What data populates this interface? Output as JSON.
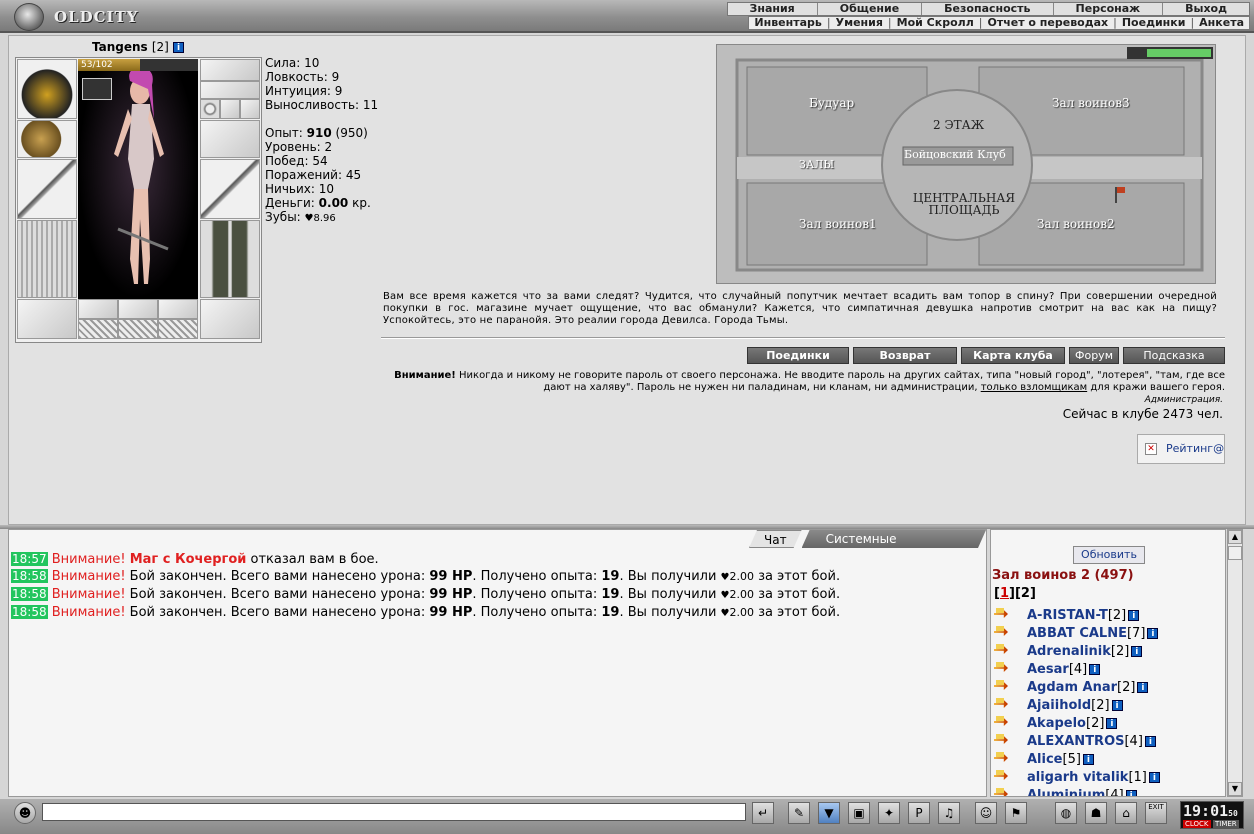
{
  "header": {
    "logo_text": "OLDCITY",
    "menu_top": [
      "Знания",
      "Общение",
      "Безопасность",
      "Персонаж",
      "Выход"
    ],
    "menu_sub": [
      "Инвентарь",
      "Умения",
      "Мой Скролл",
      "Отчет о переводах",
      "Поединки",
      "Анкета"
    ]
  },
  "character": {
    "name": "Tangens",
    "level": "[2]",
    "hp": "53/102",
    "hp_fraction": 0.52,
    "stats": [
      {
        "label": "Сила:",
        "value": "10"
      },
      {
        "label": "Ловкость:",
        "value": "9"
      },
      {
        "label": "Интуиция:",
        "value": "9"
      },
      {
        "label": "Выносливость:",
        "value": "11"
      }
    ],
    "exp_label": "Опыт:",
    "exp_value": "910",
    "exp_next": "(950)",
    "level_label": "Уровень:",
    "level_value": "2",
    "wins_label": "Побед:",
    "wins_value": "54",
    "losses_label": "Поражений:",
    "losses_value": "45",
    "draws_label": "Ничьих:",
    "draws_value": "10",
    "money_label": "Деньги:",
    "money_value": "0.00",
    "money_unit": "кр.",
    "teeth_label": "Зубы:",
    "teeth_value": "8.96"
  },
  "map": {
    "rooms": [
      "Будуар",
      "Зал воинов3",
      "2 ЭТАЖ",
      "Бойцовский Клуб",
      "ЗАЛЫ",
      "ЦЕНТРАЛЬНАЯ ПЛОЩАДЬ",
      "Зал воинов1",
      "Зал воинов2"
    ]
  },
  "flavor_text": "Вам все время кажется что за вами следят? Чудится, что случайный попутчик мечтает всадить вам топор в спину? При совершении очередной покупки в гос. магазине мучает ощущение, что вас обманули? Кажется, что симпатичная девушка напротив смотрит на вас как на пищу? Успокойтесь, это не паранойя. Это реалии города Девилса. Города Тьмы.",
  "buttons": [
    "Поединки",
    "Возврат",
    "Карта клуба",
    "Форум",
    "Подсказка"
  ],
  "warning": {
    "label": "Внимание!",
    "text_1": " Никогда и никому не говорите пароль от своего персонажа. Не вводите пароль на других сайтах, типа \"новый город\", \"лотерея\", \"там, где все дают на халяву\". Пароль не нужен ни паладинам, ни кланам, ни администрации, ",
    "link": "только взломщикам",
    "text_2": " для кражи вашего героя.",
    "signature": "Администрация."
  },
  "online": "Сейчас в клубе 2473 чел.",
  "rating_label": "Рейтинг@",
  "chat": {
    "tabs": [
      "Чат",
      "Системные сообщения"
    ],
    "messages": [
      {
        "time": "18:57",
        "prefix": "Внимание!",
        "nick": "Маг с Кочергой",
        "text": " отказал вам в бое."
      },
      {
        "time": "18:58",
        "prefix": "Внимание!",
        "text": " Бой закончен. Всего вами нанесено урона: ",
        "dmg": "99 HP",
        "text2": ". Получено опыта: ",
        "exp": "19",
        "text3": ". Вы получили ",
        "teeth": "2.00",
        "text4": " за этот бой."
      },
      {
        "time": "18:58",
        "prefix": "Внимание!",
        "text": " Бой закончен. Всего вами нанесено урона: ",
        "dmg": "99 HP",
        "text2": ". Получено опыта: ",
        "exp": "19",
        "text3": ". Вы получили ",
        "teeth": "2.00",
        "text4": " за этот бой."
      },
      {
        "time": "18:58",
        "prefix": "Внимание!",
        "text": " Бой закончен. Всего вами нанесено урона: ",
        "dmg": "99 HP",
        "text2": ". Получено опыта: ",
        "exp": "19",
        "text3": ". Вы получили ",
        "teeth": "2.00",
        "text4": " за этот бой."
      }
    ]
  },
  "players": {
    "refresh_label": "Обновить",
    "room": "Зал воинов 2 (497)",
    "pages": [
      "1",
      "2"
    ],
    "list": [
      {
        "name": "A-RISTAN-T",
        "level": "[2]"
      },
      {
        "name": "ABBAT CALNE",
        "level": "[7]"
      },
      {
        "name": "Adrenalinik",
        "level": "[2]"
      },
      {
        "name": "Aesar",
        "level": "[4]"
      },
      {
        "name": "Agdam Anar",
        "level": "[2]"
      },
      {
        "name": "Ajaiihold",
        "level": "[2]"
      },
      {
        "name": "Akapelo",
        "level": "[2]"
      },
      {
        "name": "ALEXANTROS",
        "level": "[4]"
      },
      {
        "name": "Alice",
        "level": "[5]"
      },
      {
        "name": "aligarh vitalik",
        "level": "[1]"
      },
      {
        "name": "Aluminium",
        "level": "[4]"
      }
    ]
  },
  "clock": {
    "time": "19:01",
    "seconds": "50",
    "label_clock": "CLOCK",
    "label_timer": "TIMER",
    "exit": "EXIT"
  }
}
